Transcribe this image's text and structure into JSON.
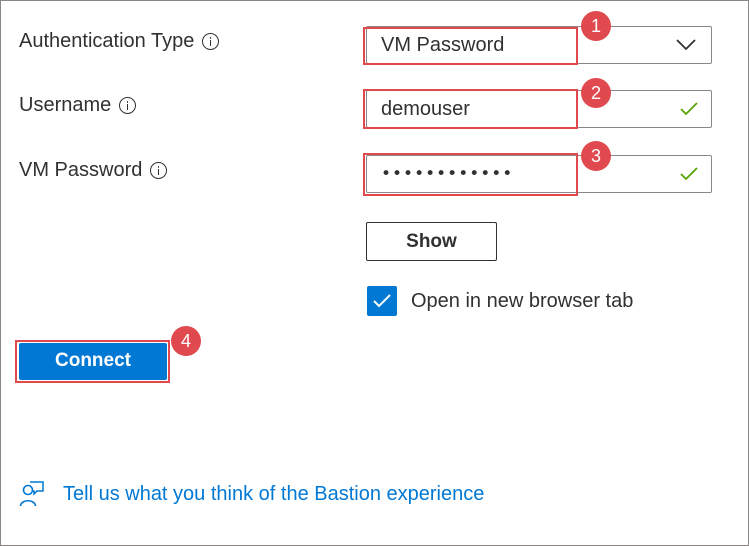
{
  "form": {
    "auth_type": {
      "label": "Authentication Type",
      "value": "VM Password"
    },
    "username": {
      "label": "Username",
      "value": "demouser"
    },
    "vm_password": {
      "label": "VM Password",
      "value": "••••••••••••"
    },
    "show_label": "Show",
    "open_new_tab": {
      "label": "Open in new browser tab",
      "checked": true
    },
    "connect_label": "Connect"
  },
  "feedback": {
    "link_text": "Tell us what you think of the Bastion experience"
  },
  "callouts": [
    "1",
    "2",
    "3",
    "4"
  ],
  "colors": {
    "accent": "#0078d4",
    "callout": "#e04a4f",
    "valid": "#57a300"
  },
  "icons": [
    "info-icon",
    "chevron-down-icon",
    "checkmark-icon",
    "feedback-icon"
  ]
}
